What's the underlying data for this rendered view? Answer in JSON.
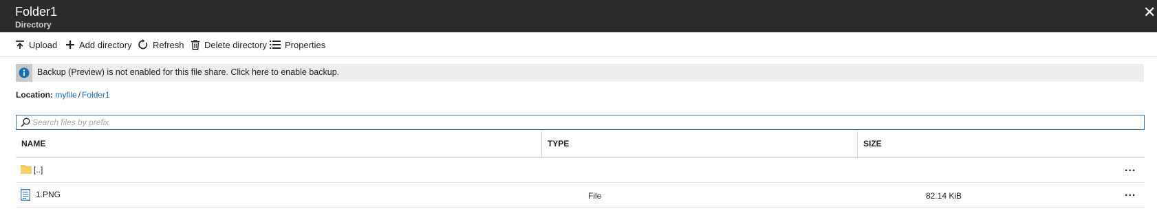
{
  "header": {
    "title": "Folder1",
    "subtitle": "Directory",
    "close_icon": "close-icon"
  },
  "toolbar": {
    "upload": "Upload",
    "add_directory": "Add directory",
    "refresh": "Refresh",
    "delete_directory": "Delete directory",
    "properties": "Properties"
  },
  "banner": {
    "icon": "info-icon",
    "message": "Backup (Preview) is not enabled for this file share. Click here to enable backup."
  },
  "location": {
    "label": "Location:",
    "path": [
      "myfile",
      "Folder1"
    ],
    "separator": "/"
  },
  "search": {
    "placeholder": "Search files by prefix",
    "value": ""
  },
  "table": {
    "columns": [
      "NAME",
      "TYPE",
      "SIZE"
    ],
    "rows": [
      {
        "icon": "folder-icon",
        "name": "[..]",
        "type": "",
        "size": "",
        "more": "..."
      },
      {
        "icon": "file-icon",
        "name": "1.PNG",
        "type": "File",
        "size": "82.14 KiB",
        "more": "..."
      }
    ]
  },
  "colors": {
    "header_bg": "#2b2b2b",
    "link": "#1a6bb5",
    "info": "#1a6bb5",
    "folder": "#f3c44b"
  }
}
